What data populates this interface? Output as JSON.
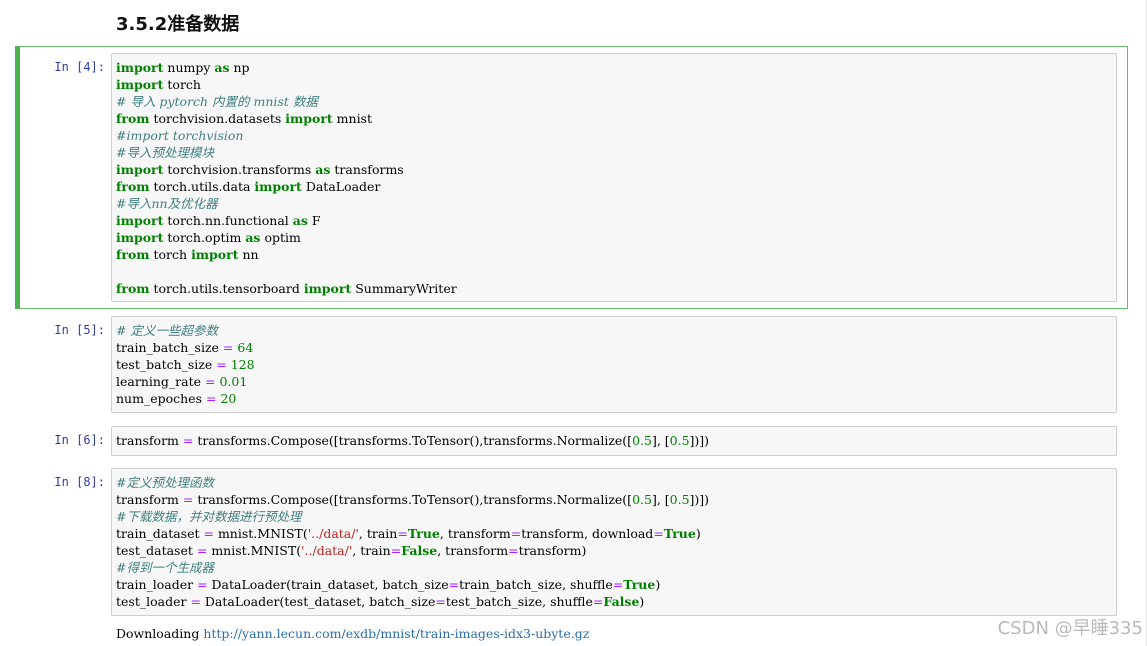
{
  "heading": "3.5.2准备数据",
  "cells": [
    {
      "prompt": "In  [4]:",
      "lines": [
        [
          [
            "kw",
            "import"
          ],
          [
            "t",
            " numpy "
          ],
          [
            "kw",
            "as"
          ],
          [
            "t",
            " np"
          ]
        ],
        [
          [
            "kw",
            "import"
          ],
          [
            "t",
            " torch"
          ]
        ],
        [
          [
            "cm",
            "# 导入 pytorch 内置的 mnist 数据"
          ]
        ],
        [
          [
            "kw",
            "from"
          ],
          [
            "t",
            " torchvision.datasets "
          ],
          [
            "kw",
            "import"
          ],
          [
            "t",
            " mnist"
          ]
        ],
        [
          [
            "cm",
            "#import torchvision"
          ]
        ],
        [
          [
            "cm",
            "#导入预处理模块"
          ]
        ],
        [
          [
            "kw",
            "import"
          ],
          [
            "t",
            " torchvision.transforms "
          ],
          [
            "kw",
            "as"
          ],
          [
            "t",
            " transforms"
          ]
        ],
        [
          [
            "kw",
            "from"
          ],
          [
            "t",
            " torch.utils.data "
          ],
          [
            "kw",
            "import"
          ],
          [
            "t",
            " DataLoader"
          ]
        ],
        [
          [
            "cm",
            "#导入nn及优化器"
          ]
        ],
        [
          [
            "kw",
            "import"
          ],
          [
            "t",
            " torch.nn.functional "
          ],
          [
            "kw",
            "as"
          ],
          [
            "t",
            " F"
          ]
        ],
        [
          [
            "kw",
            "import"
          ],
          [
            "t",
            " torch.optim "
          ],
          [
            "kw",
            "as"
          ],
          [
            "t",
            " optim"
          ]
        ],
        [
          [
            "kw",
            "from"
          ],
          [
            "t",
            " torch "
          ],
          [
            "kw",
            "import"
          ],
          [
            "t",
            " nn"
          ]
        ],
        [
          [
            "t",
            ""
          ]
        ],
        [
          [
            "kw",
            "from"
          ],
          [
            "t",
            " torch.utils.tensorboard "
          ],
          [
            "kw",
            "import"
          ],
          [
            "t",
            " SummaryWriter"
          ]
        ]
      ]
    },
    {
      "prompt": "In  [5]:",
      "lines": [
        [
          [
            "cm",
            "# 定义一些超参数"
          ]
        ],
        [
          [
            "t",
            "train_batch_size "
          ],
          [
            "op",
            "="
          ],
          [
            "t",
            " "
          ],
          [
            "nm",
            "64"
          ]
        ],
        [
          [
            "t",
            "test_batch_size "
          ],
          [
            "op",
            "="
          ],
          [
            "t",
            " "
          ],
          [
            "nm",
            "128"
          ]
        ],
        [
          [
            "t",
            "learning_rate "
          ],
          [
            "op",
            "="
          ],
          [
            "t",
            " "
          ],
          [
            "nm",
            "0.01"
          ]
        ],
        [
          [
            "t",
            "num_epoches "
          ],
          [
            "op",
            "="
          ],
          [
            "t",
            " "
          ],
          [
            "nm",
            "20"
          ]
        ]
      ]
    },
    {
      "prompt": "In  [6]:",
      "lines": [
        [
          [
            "t",
            "transform "
          ],
          [
            "op",
            "="
          ],
          [
            "t",
            " transforms.Compose([transforms.ToTensor(),transforms.Normalize(["
          ],
          [
            "nm",
            "0.5"
          ],
          [
            "t",
            "], ["
          ],
          [
            "nm",
            "0.5"
          ],
          [
            "t",
            "])])"
          ]
        ]
      ]
    },
    {
      "prompt": "In  [8]:",
      "lines": [
        [
          [
            "cm",
            "#定义预处理函数"
          ]
        ],
        [
          [
            "t",
            "transform "
          ],
          [
            "op",
            "="
          ],
          [
            "t",
            " transforms.Compose([transforms.ToTensor(),transforms.Normalize(["
          ],
          [
            "nm",
            "0.5"
          ],
          [
            "t",
            "], ["
          ],
          [
            "nm",
            "0.5"
          ],
          [
            "t",
            "])])"
          ]
        ],
        [
          [
            "cm",
            "#下载数据，并对数据进行预处理"
          ]
        ],
        [
          [
            "t",
            "train_dataset "
          ],
          [
            "op",
            "="
          ],
          [
            "t",
            " mnist.MNIST("
          ],
          [
            "str",
            "'../data/'"
          ],
          [
            "t",
            ", train"
          ],
          [
            "op",
            "="
          ],
          [
            "kw",
            "True"
          ],
          [
            "t",
            ", transform"
          ],
          [
            "op",
            "="
          ],
          [
            "t",
            "transform, download"
          ],
          [
            "op",
            "="
          ],
          [
            "kw",
            "True"
          ],
          [
            "t",
            ")"
          ]
        ],
        [
          [
            "t",
            "test_dataset "
          ],
          [
            "op",
            "="
          ],
          [
            "t",
            " mnist.MNIST("
          ],
          [
            "str",
            "'../data/'"
          ],
          [
            "t",
            ", train"
          ],
          [
            "op",
            "="
          ],
          [
            "kw",
            "False"
          ],
          [
            "t",
            ", transform"
          ],
          [
            "op",
            "="
          ],
          [
            "t",
            "transform)"
          ]
        ],
        [
          [
            "cm",
            "#得到一个生成器"
          ]
        ],
        [
          [
            "t",
            "train_loader "
          ],
          [
            "op",
            "="
          ],
          [
            "t",
            " DataLoader(train_dataset, batch_size"
          ],
          [
            "op",
            "="
          ],
          [
            "t",
            "train_batch_size, shuffle"
          ],
          [
            "op",
            "="
          ],
          [
            "kw",
            "True"
          ],
          [
            "t",
            ")"
          ]
        ],
        [
          [
            "t",
            "test_loader "
          ],
          [
            "op",
            "="
          ],
          [
            "t",
            " DataLoader(test_dataset, batch_size"
          ],
          [
            "op",
            "="
          ],
          [
            "t",
            "test_batch_size, shuffle"
          ],
          [
            "op",
            "="
          ],
          [
            "kw",
            "False"
          ],
          [
            "t",
            ")"
          ]
        ]
      ]
    }
  ],
  "output": {
    "prefix": "Downloading ",
    "link": "http://yann.lecun.com/exdb/mnist/train-images-idx3-ubyte.gz"
  },
  "watermark": "CSDN @早睡335"
}
